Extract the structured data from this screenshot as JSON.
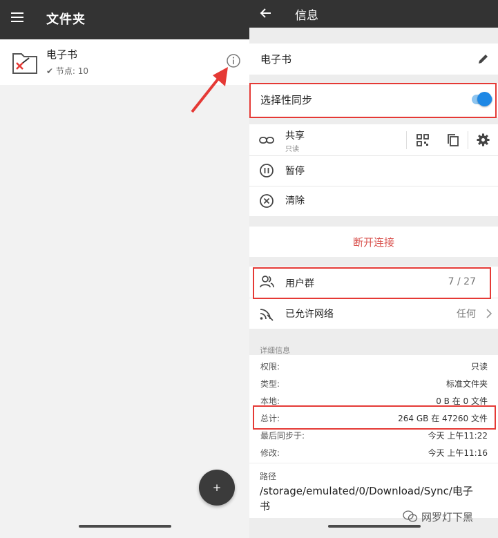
{
  "left": {
    "title": "文件夹",
    "folder": {
      "name": "电子书",
      "nodes": "✔ 节点: 10"
    },
    "fab_label": "+"
  },
  "right": {
    "title": "信息",
    "folder_name": "电子书",
    "selective_sync": {
      "label": "选择性同步",
      "on": true
    },
    "share": {
      "label": "共享",
      "sub": "只读"
    },
    "pause_label": "暂停",
    "clear_label": "清除",
    "disconnect_label": "断开连接",
    "cluster": {
      "label": "用户群",
      "value": "7 / 27"
    },
    "allowed_networks": {
      "label": "已允许网络",
      "value": "任何"
    },
    "details": {
      "header": "详细信息",
      "rows": [
        {
          "label": "权限:",
          "value": "只读"
        },
        {
          "label": "类型:",
          "value": "标准文件夹"
        },
        {
          "label": "本地:",
          "value": "0 B 在 0 文件"
        },
        {
          "label": "总计:",
          "value": "264 GB 在 47260 文件"
        },
        {
          "label": "最后同步于:",
          "value": "今天 上午11:22"
        },
        {
          "label": "修改:",
          "value": "今天 上午11:16"
        }
      ]
    },
    "path": {
      "label": "路径",
      "line1": "/storage/emulated/0/Download/Sync/电子",
      "line2": "书"
    }
  },
  "watermark": "网罗灯下黑",
  "colors": {
    "toolbar": "#333333",
    "accent_blue": "#1e88e5",
    "disconnect_red": "#d9534f",
    "highlight_red": "#e53935"
  }
}
